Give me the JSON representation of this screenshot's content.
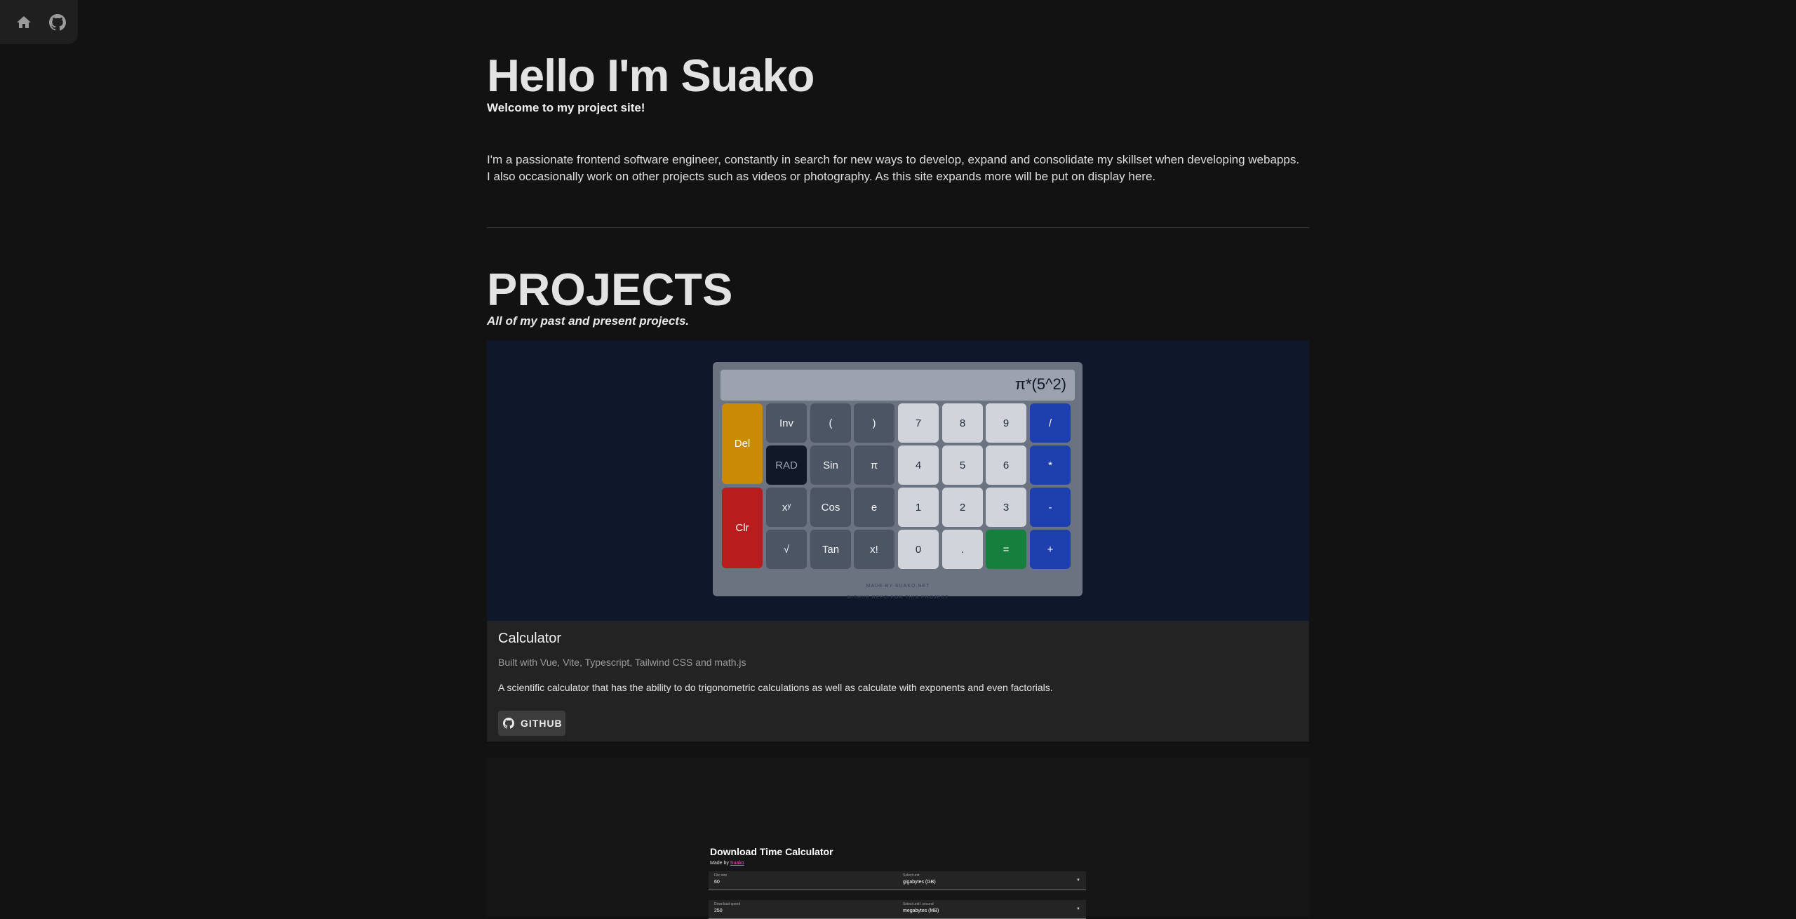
{
  "nav": {
    "home_icon": "home-icon",
    "github_icon": "github-icon"
  },
  "hero": {
    "title": "Hello I'm Suako",
    "subtitle": "Welcome to my project site!",
    "intro_line1": "I'm a passionate frontend software engineer, constantly in search for new ways to develop, expand and consolidate my skillset when developing webapps.",
    "intro_line2": "I also occasionally work on other projects such as videos or photography. As this site expands more will be put on display here."
  },
  "projects": {
    "title": "PROJECTS",
    "subtitle": "All of my past and present projects."
  },
  "calculator_project": {
    "display": "π*(5^2)",
    "keys": {
      "del": "Del",
      "clr": "Clr",
      "inv": "Inv",
      "lparen": "(",
      "rparen": ")",
      "rad": "RAD",
      "sin": "Sin",
      "pi": "π",
      "pow": "xʸ",
      "cos": "Cos",
      "e": "e",
      "sqrt": "√",
      "tan": "Tan",
      "fact": "x!",
      "n7": "7",
      "n8": "8",
      "n9": "9",
      "div": "/",
      "n4": "4",
      "n5": "5",
      "n6": "6",
      "mul": "*",
      "n1": "1",
      "n2": "2",
      "n3": "3",
      "sub": "-",
      "n0": "0",
      "dot": ".",
      "eq": "=",
      "add": "+"
    },
    "made_by": "MADE BY SUAKO.NET",
    "repo_note": "GITHUB REPO FOR THIS PROJECT",
    "title": "Calculator",
    "built_with": "Built with Vue, Vite, Typescript, Tailwind CSS and math.js",
    "description": "A scientific calculator that has the ability to do trigonometric calculations as well as calculate with exponents and even factorials.",
    "github_label": "GITHUB"
  },
  "download_project": {
    "title": "Download Time Calculator",
    "made_by_prefix": "Made by ",
    "made_by_name": "Suako",
    "file_size_label": "File size",
    "file_size_value": "60",
    "unit_label": "Select unit",
    "unit_value": "gigabytes (GB)",
    "speed_label": "Download speed",
    "speed_value": "250",
    "speed_unit_label": "Select unit / second",
    "speed_unit_value": "megabytes (MB)"
  },
  "colors": {
    "background": "#121212",
    "card": "#232323",
    "calc_preview_bg": "#0f172a",
    "operator_blue": "#1e40af",
    "equals_green": "#15803d",
    "delete_yellow": "#ca8a04",
    "clear_red": "#b91c1c"
  }
}
